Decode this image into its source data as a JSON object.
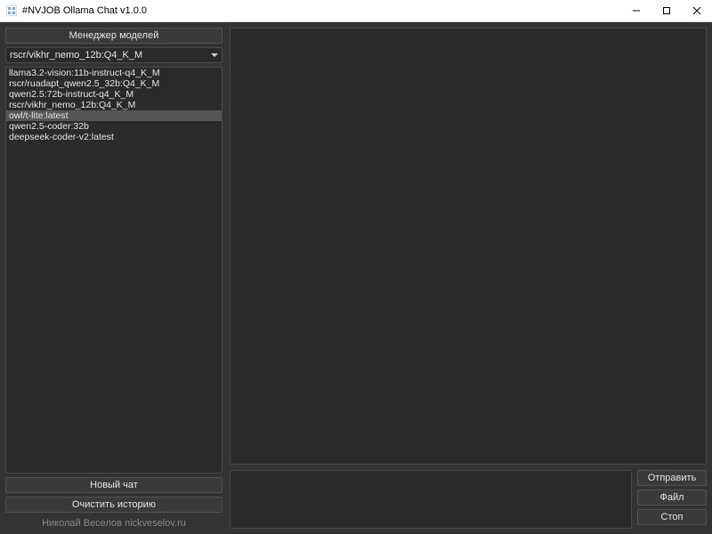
{
  "titlebar": {
    "title": "#NVJOB Ollama Chat v1.0.0"
  },
  "left": {
    "manager_button": "Менеджер моделей",
    "selected_model": "rscr/vikhr_nemo_12b:Q4_K_M",
    "models": [
      "llama3.2-vision:11b-instruct-q4_K_M",
      "rscr/ruadapt_qwen2.5_32b:Q4_K_M",
      "qwen2.5:72b-instruct-q4_K_M",
      "rscr/vikhr_nemo_12b:Q4_K_M",
      "owl/t-lite:latest",
      "qwen2.5-coder:32b",
      "deepseek-coder-v2:latest"
    ],
    "selected_index": 4,
    "new_chat": "Новый чат",
    "clear_history": "Очистить историю",
    "footer": "Николай Веселов nickveselov.ru"
  },
  "right": {
    "send": "Отправить",
    "file": "Файл",
    "stop": "Стоп"
  }
}
